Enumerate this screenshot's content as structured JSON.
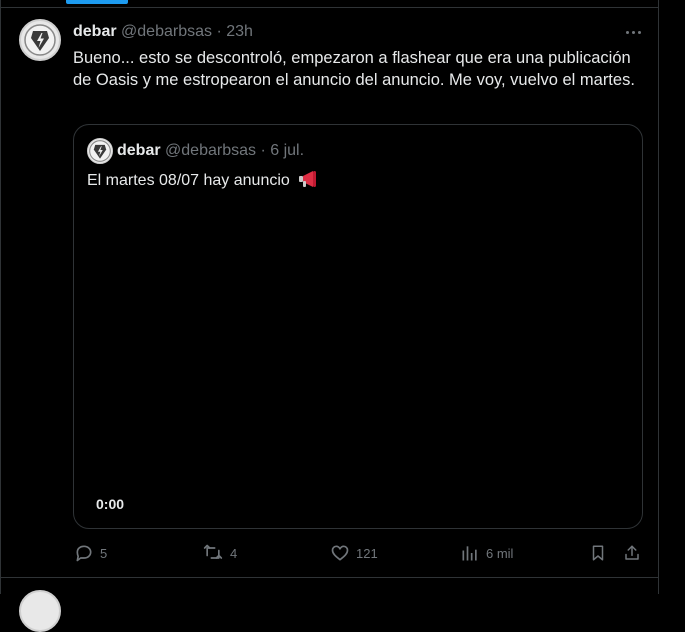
{
  "tweet": {
    "author_name": "debar",
    "author_handle": "@debarbsas",
    "separator": "·",
    "time": "23h",
    "text": "Bueno... esto se descontroló, empezaron a flashear que era una publicación de Oasis y me estropearon el anuncio del anuncio. Me voy, vuelvo el martes."
  },
  "quote": {
    "author_name": "debar",
    "author_handle": "@debarbsas",
    "separator": "·",
    "time": "6 jul.",
    "text": "El martes 08/07 hay anuncio",
    "video_time": "0:00"
  },
  "actions": {
    "replies": "5",
    "reposts": "4",
    "likes": "121",
    "views": "6 mil"
  },
  "colors": {
    "accent": "#1d9bf0",
    "muted": "#71767b",
    "text": "#e7e9ea",
    "border": "#2f3336"
  }
}
